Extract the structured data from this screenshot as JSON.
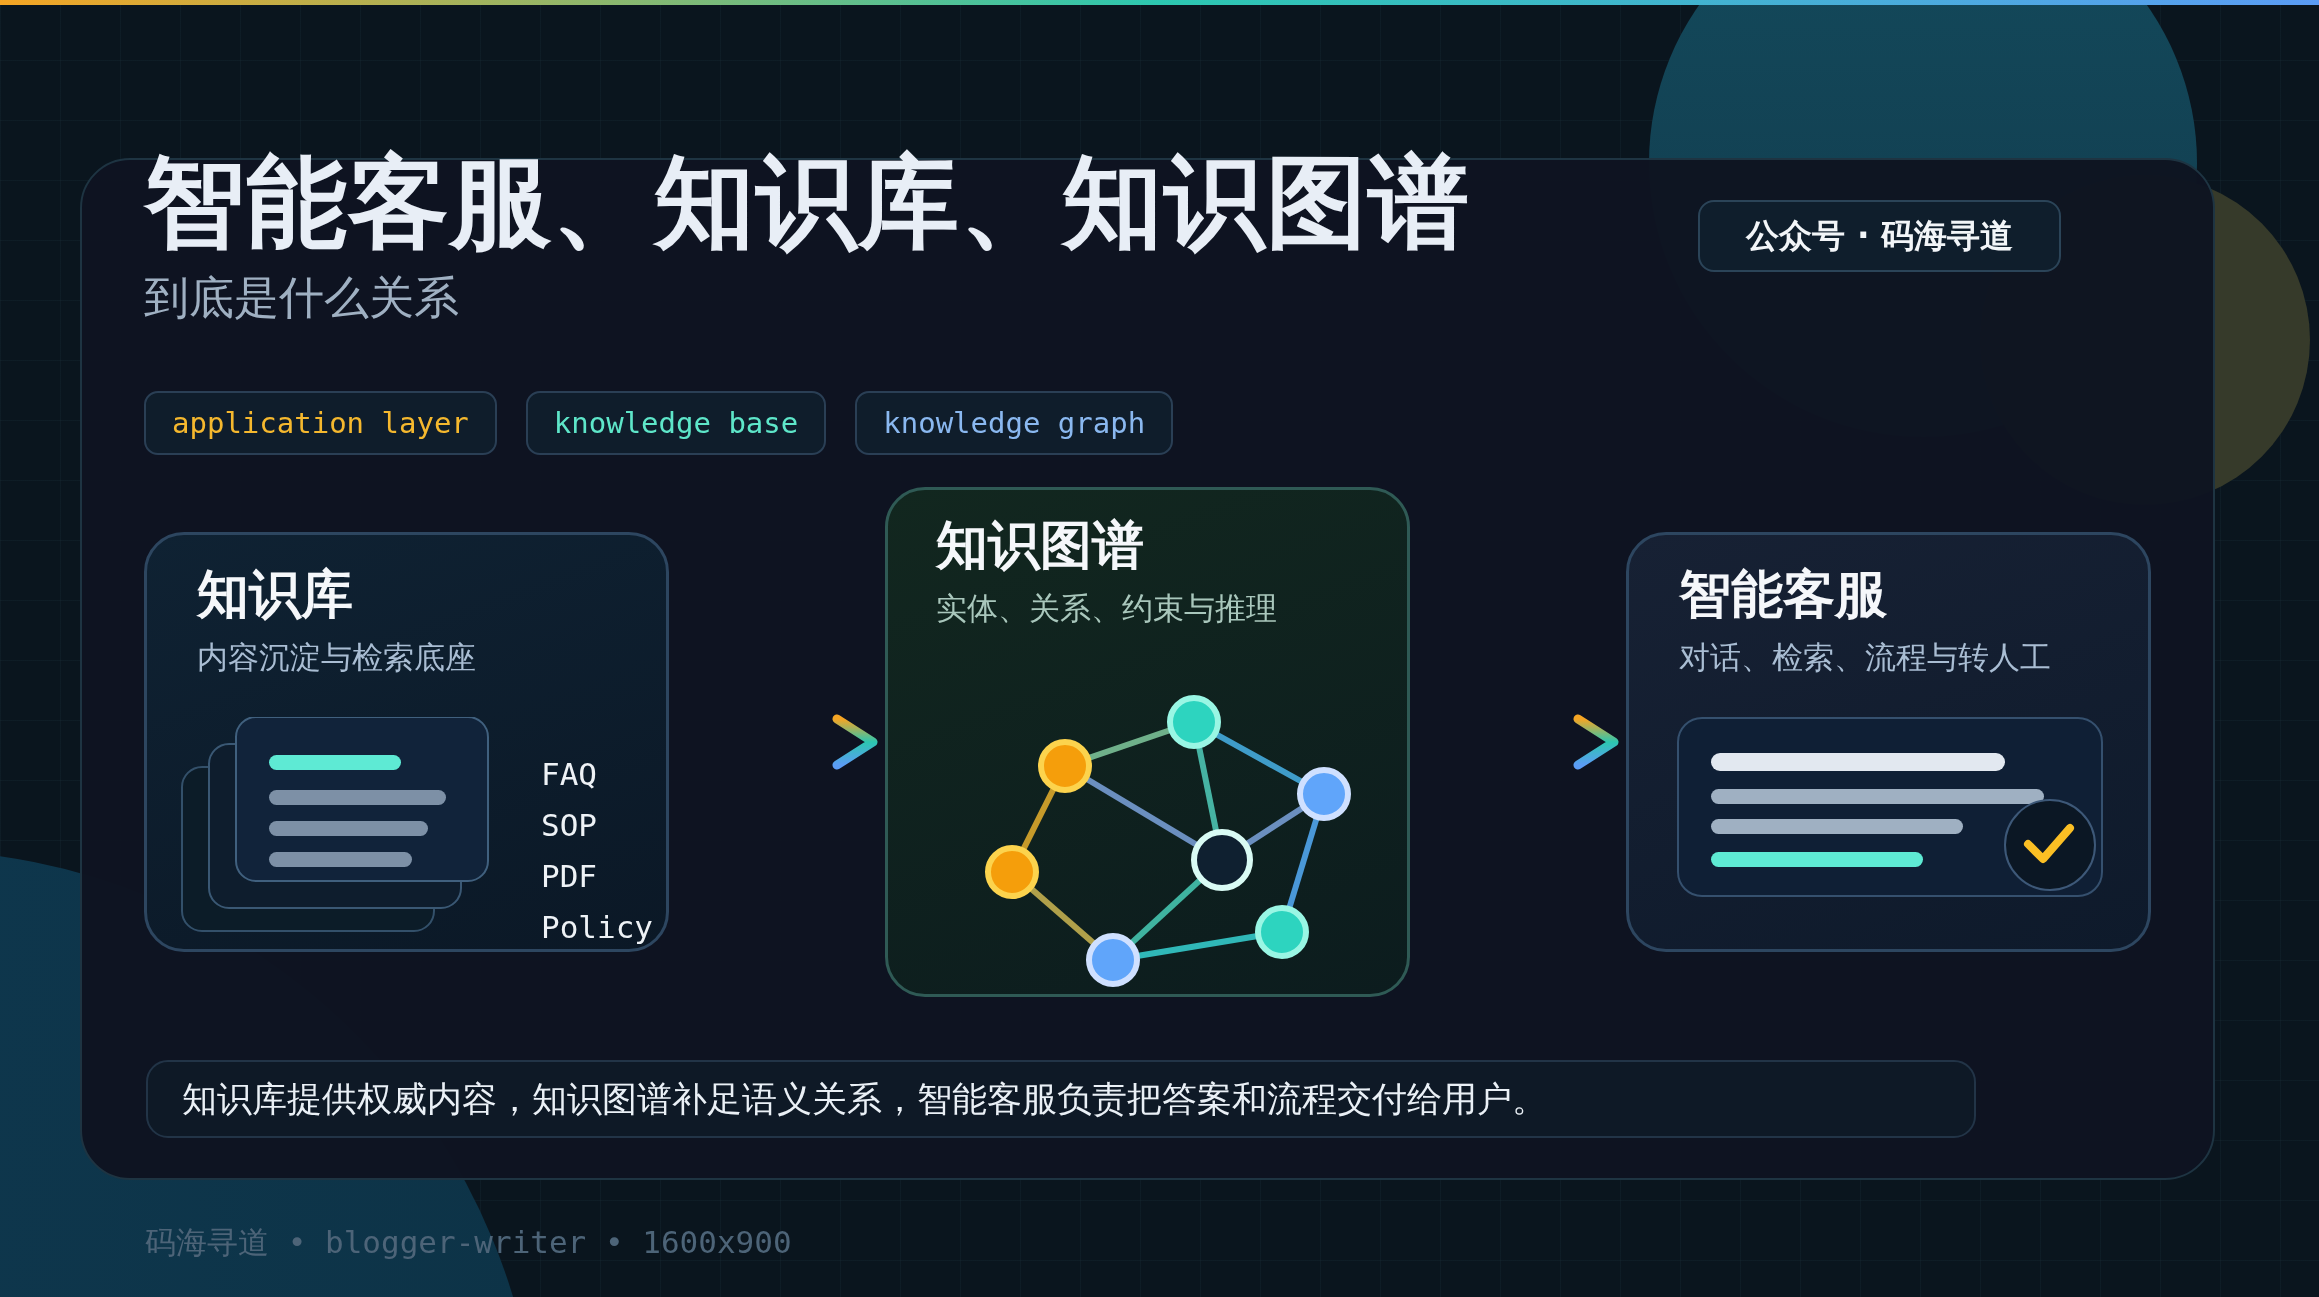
{
  "header": {
    "title": "智能客服、知识库、知识图谱",
    "subtitle": "到底是什么关系",
    "badge": "公众号 · 码海寻道"
  },
  "tags": [
    {
      "label": "application layer",
      "color": "#f5b82e"
    },
    {
      "label": "knowledge base",
      "color": "#5ee6c9"
    },
    {
      "label": "knowledge graph",
      "color": "#8ab8f0"
    }
  ],
  "cards": [
    {
      "kind": "documents",
      "title": "知识库",
      "subtitle": "内容沉淀与检索底座",
      "labels": [
        "FAQ",
        "SOP",
        "PDF",
        "Policy"
      ]
    },
    {
      "kind": "graph",
      "title": "知识图谱",
      "subtitle": "实体、关系、约束与推理"
    },
    {
      "kind": "answer",
      "title": "智能客服",
      "subtitle": "对话、检索、流程与转人工"
    }
  ],
  "summary": "知识库提供权威内容，知识图谱补足语义关系，智能客服负责把答案和流程交付给用户。",
  "footer": "码海寻道 • blogger-writer • 1600x900"
}
